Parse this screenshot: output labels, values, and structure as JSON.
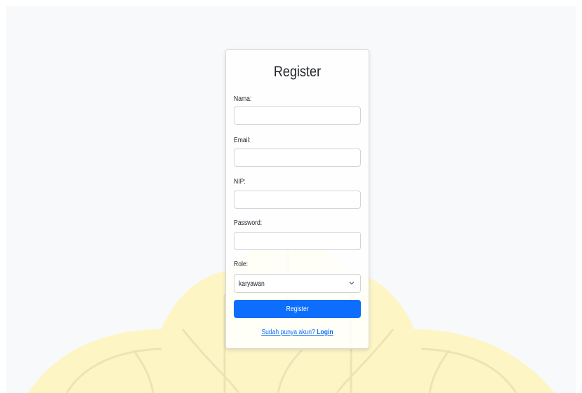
{
  "form": {
    "title": "Register",
    "fields": [
      {
        "label": "Nama:",
        "value": "",
        "placeholder": ""
      },
      {
        "label": "Email:",
        "value": "",
        "placeholder": ""
      },
      {
        "label": "NIP:",
        "value": "",
        "placeholder": ""
      },
      {
        "label": "Password:",
        "value": "",
        "placeholder": ""
      }
    ],
    "role": {
      "label": "Role:",
      "selected": "karyawan"
    },
    "submit_label": "Register",
    "login_prompt": "Sudah punya akun?",
    "login_link": "Login"
  },
  "colors": {
    "primary": "#0d6efd",
    "page_background": "#f8f9fa",
    "watermark": "#fdf5c4"
  },
  "icons": {
    "select_arrow": "chevron-down-icon",
    "background": "watermark-logo"
  }
}
